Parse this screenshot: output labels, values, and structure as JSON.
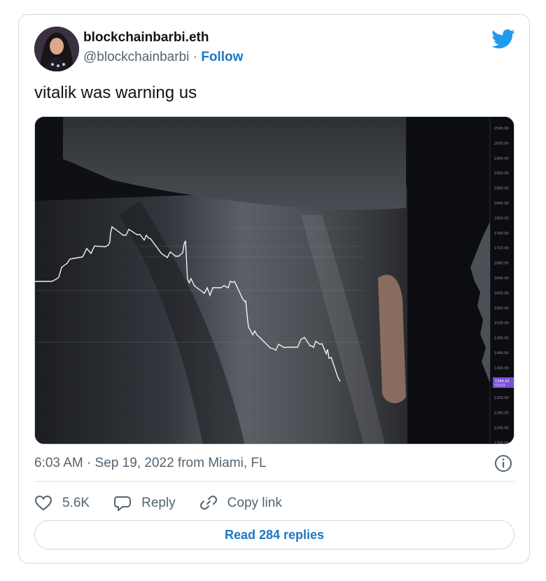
{
  "tweet": {
    "display_name": "blockchainbarbi.eth",
    "handle": "@blockchainbarbi",
    "separator": " · ",
    "follow_label": "Follow",
    "text": "vitalik was warning us",
    "timestamp": "6:03 AM · Sep 19, 2022 from Miami, FL",
    "likes": "5.6K",
    "reply_label": "Reply",
    "copy_link_label": "Copy link",
    "read_replies_label": "Read 284 replies"
  },
  "media": {
    "price_axis": [
      "2040.00",
      "2000.00",
      "1960.00",
      "1920.00",
      "1880.00",
      "1840.00",
      "1800.00",
      "1760.00",
      "1720.00",
      "1680.00",
      "1640.00",
      "1600.00",
      "1560.00",
      "1520.00",
      "1480.00",
      "1440.00",
      "1400.00",
      "1360.00",
      "1320.00",
      "1280.00",
      "1240.00",
      "1200.00"
    ],
    "current_price": "1364.92",
    "current_price_sub": "53:03"
  },
  "colors": {
    "link_blue": "#1d77c2",
    "twitter_blue": "#1d9bf0",
    "price_tag": "#7b4fd6"
  },
  "icons": [
    "twitter-bird-icon",
    "info-icon",
    "heart-icon",
    "reply-bubble-icon",
    "link-icon"
  ]
}
